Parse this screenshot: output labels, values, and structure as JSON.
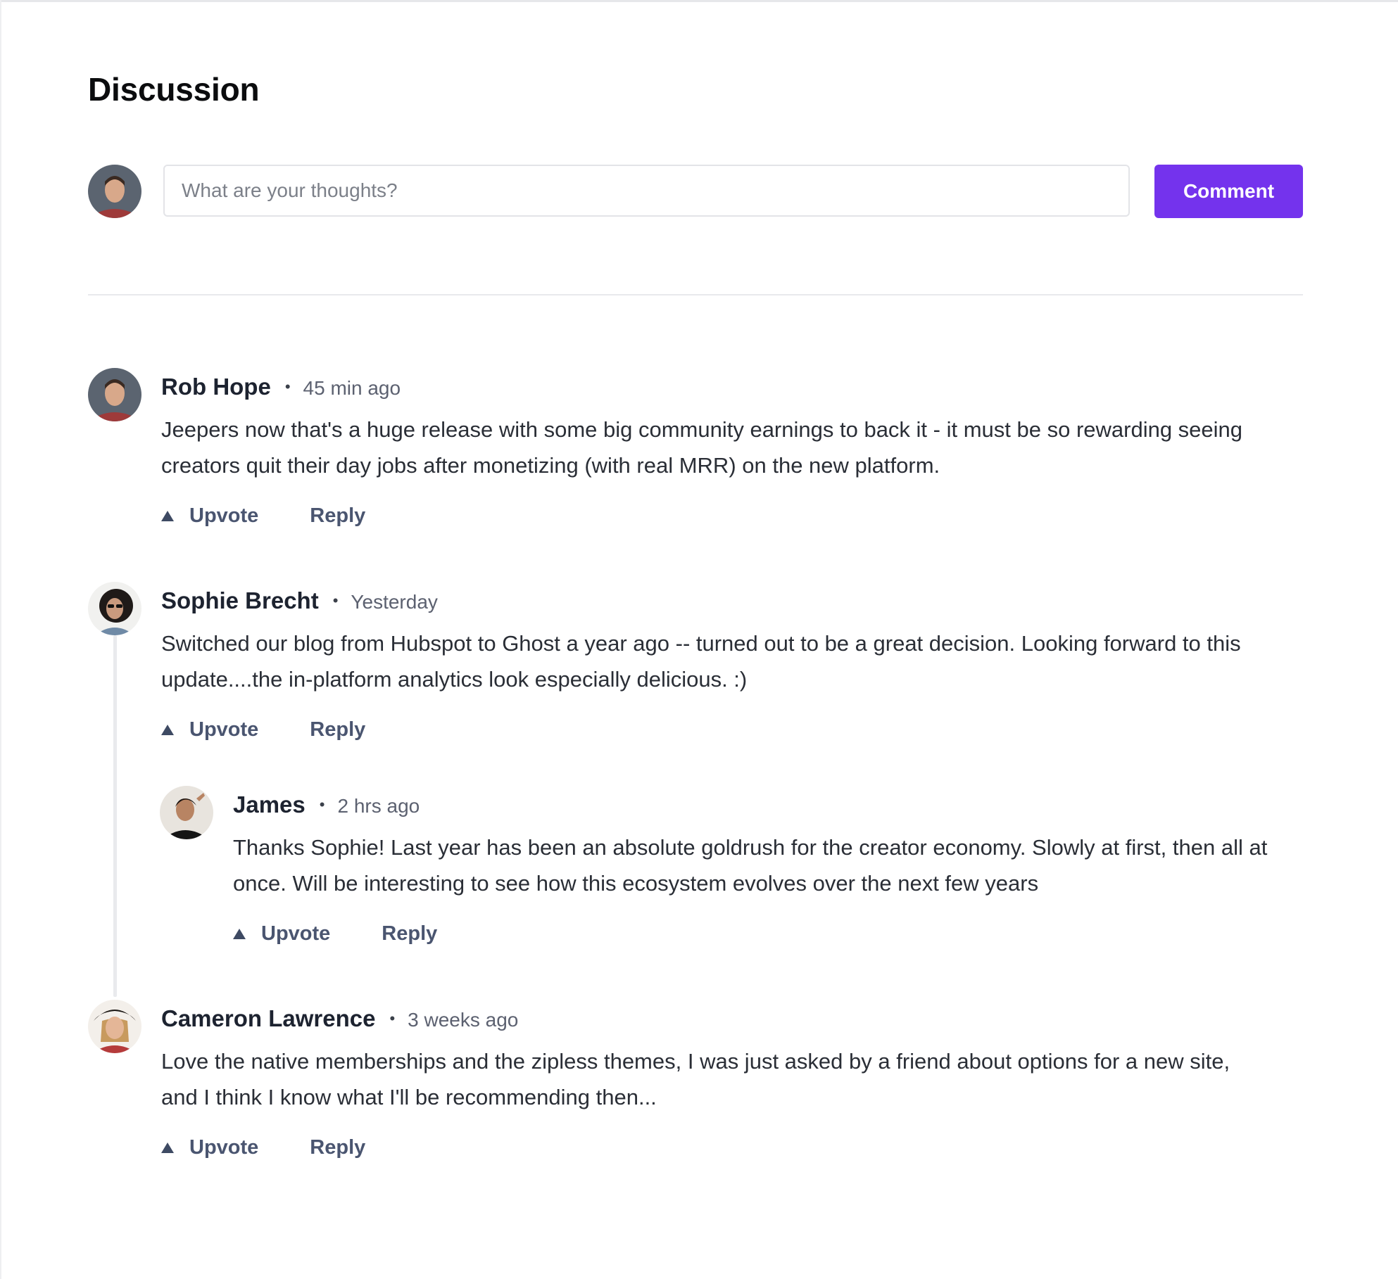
{
  "page": {
    "title": "Discussion"
  },
  "composer": {
    "placeholder": "What are your thoughts?",
    "value": "",
    "button_label": "Comment"
  },
  "actions": {
    "upvote_label": "Upvote",
    "reply_label": "Reply"
  },
  "separator": "•",
  "comments": [
    {
      "name": "Rob Hope",
      "time": "45 min ago",
      "body": "Jeepers now that's a huge release with some big community earnings to back it - it must be so rewarding seeing creators quit their day jobs after monetizing (with real MRR) on the new platform."
    },
    {
      "name": "Sophie Brecht",
      "time": "Yesterday",
      "body": "Switched our blog from Hubspot to Ghost a year ago -- turned out to be a great decision. Looking forward to this update....the in-platform analytics look especially delicious. :)",
      "replies": [
        {
          "name": "James",
          "time": "2 hrs ago",
          "body": "Thanks Sophie! Last year has been an absolute goldrush for the creator economy. Slowly at first, then all at once. Will be interesting to see how this ecosystem evolves over the next few years"
        }
      ]
    },
    {
      "name": "Cameron Lawrence",
      "time": "3 weeks ago",
      "body": "Love the native memberships and the zipless themes, I was just asked by a friend about options for a new site, and I think I know what I'll be recommending then..."
    }
  ],
  "colors": {
    "accent": "#7433ed",
    "action_text": "#4a5570",
    "border": "#e3e4e8"
  }
}
